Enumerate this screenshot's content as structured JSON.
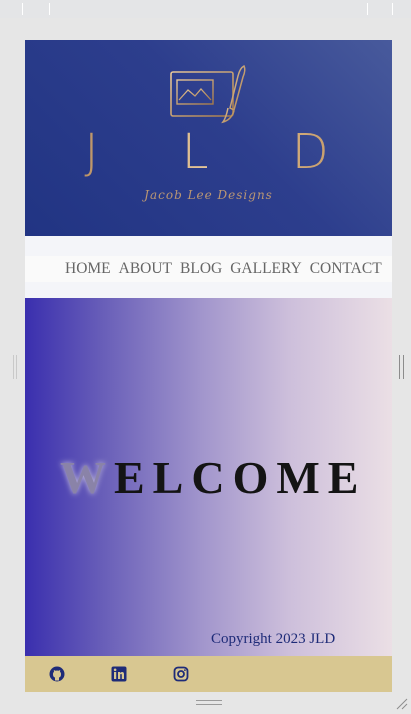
{
  "header": {
    "logo_letters": "J L D",
    "logo_script": "Jacob Lee Designs",
    "logo_icon": "easel-paintbrush-icon",
    "colors": {
      "gold": "#c9a26b",
      "navy": "#213483"
    }
  },
  "nav": {
    "items": [
      "HOME",
      "ABOUT",
      "BLOG",
      "GALLERY",
      "CONTACT"
    ]
  },
  "hero": {
    "title_first": "W",
    "title_rest": "ELCOME",
    "colors": {
      "start": "#3a2fae",
      "end": "#ebdfe5"
    }
  },
  "footer": {
    "icons": [
      "github-icon",
      "linkedin-icon",
      "instagram-icon"
    ],
    "copyright": "Copyright 2023 JLD",
    "background": "#d8c791"
  }
}
